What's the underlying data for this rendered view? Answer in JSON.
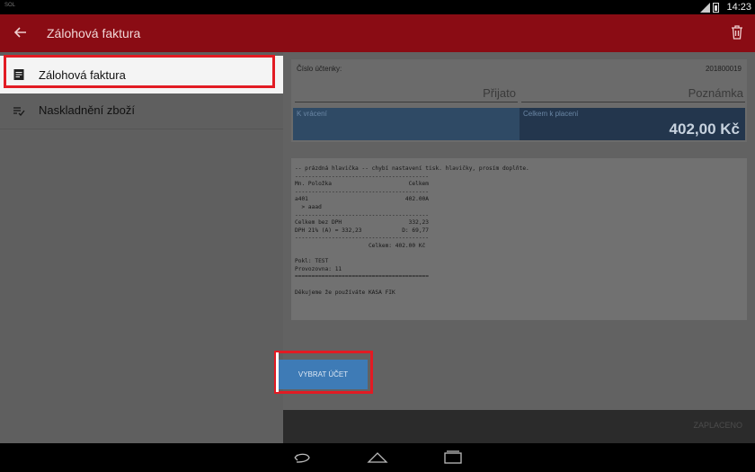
{
  "statusbar": {
    "carrier": "SOL",
    "time": "14:23"
  },
  "appbar": {
    "title": "Zálohová faktura"
  },
  "sidebar": {
    "items": [
      {
        "label": "Zálohová faktura"
      },
      {
        "label": "Naskladnění zboží"
      }
    ]
  },
  "receipt_card": {
    "receipt_number_label": "Číslo účtenky:",
    "receipt_number": "201800019",
    "received_placeholder": "Přijato",
    "note_placeholder": "Poznámka",
    "change_label": "K vrácení",
    "total_label": "Celkem k placení",
    "total_value": "402,00 Kč"
  },
  "receipt_preview": {
    "lines": [
      "-- prázdná hlavička -- chybí nastavení tisk. hlavičky, prosím doplňte.",
      "----------------------------------------",
      "Mn. Položka                       Celkem",
      "----------------------------------------",
      "a401                             402.00A",
      "  > aaad",
      "----------------------------------------",
      "Celkem bez DPH                    332,23",
      "DPH 21% (A) = 332,23            D: 69,77",
      "----------------------------------------",
      "                      Celkem: 402.00 Kč",
      "",
      "Pokl: TEST",
      "Provozovna: 11",
      "========================================",
      "",
      "Děkujeme že používáte KASA FIK"
    ]
  },
  "bottombar": {
    "select_button": "VYBRAT ÚČET",
    "paid_button": "ZAPLACENO"
  },
  "colors": {
    "appbar": "#8a0c14",
    "highlight": "#e21b23",
    "button": "#3e7bb6"
  }
}
